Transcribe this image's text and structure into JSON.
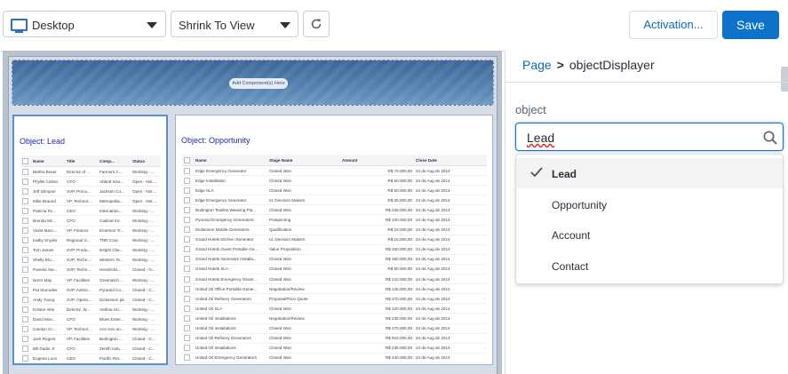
{
  "toolbar": {
    "device": "Desktop",
    "view": "Shrink To View",
    "activation_label": "Activation...",
    "save_label": "Save"
  },
  "canvas": {
    "add_component_label": "Add Component(s) Here",
    "lead": {
      "title": "Object: Lead",
      "columns": [
        "Name",
        "Title",
        "Comp...",
        "Status"
      ],
      "rows": [
        [
          "Bertha Boxer",
          "Director of ...",
          "Farmers C...",
          "Working - ..."
        ],
        [
          "Phyllis Cotton",
          "CFO",
          "Abbott Insu...",
          "Open - Not ..."
        ],
        [
          "Jeff Glimpse",
          "SVP, Procu...",
          "Jackson Co...",
          "Open - Not ..."
        ],
        [
          "Mike Braund",
          "VP, Technol...",
          "Metropolita...",
          "Open - Not ..."
        ],
        [
          "Patricia Fe...",
          "CEO",
          "Internation...",
          "Working - ..."
        ],
        [
          "Brenda Mc...",
          "CFO",
          "Cadinal Inc.",
          "Working - ..."
        ],
        [
          "Violet Macc...",
          "VP, Finance",
          "Emerson Tr...",
          "Working - ..."
        ],
        [
          "Kathy Snyder",
          "Regional G...",
          "TNR Corp.",
          "Working - ..."
        ],
        [
          "Tom James",
          "SVP, Produ...",
          "Delphi Che...",
          "Working - ..."
        ],
        [
          "Shelly Bro...",
          "SVP, Techn...",
          "Western Te...",
          "Working - ..."
        ],
        [
          "Pamela Ow...",
          "SVP, Techn...",
          "Hendricks...",
          "Closed - N..."
        ],
        [
          "Norm May",
          "VP, Facilities",
          "Greenwich ...",
          "Working - ..."
        ],
        [
          "Pat Stumuller",
          "SVP, Admin...",
          "Pyramid Co...",
          "Closed - C..."
        ],
        [
          "Andy Young",
          "SVP, Opera...",
          "Dickenson plc",
          "Closed - C..."
        ],
        [
          "Kristen Akin",
          "Director, W...",
          "Aethna Ho...",
          "Working - ..."
        ],
        [
          "David Mon...",
          "CFO",
          "Blues Enter...",
          "Working - ..."
        ],
        [
          "Carolyn Cr...",
          "VP, Technol...",
          "Ace Iron an...",
          "Working - ..."
        ],
        [
          "Jack Rogers",
          "VP, Facilities",
          "Burlington ...",
          "Closed - C..."
        ],
        [
          "Bill Dadio Jr",
          "CFO",
          "Zenith Indu...",
          "Closed - C..."
        ],
        [
          "Eugena Luce",
          "CEO",
          "Pacific Ret...",
          "Closed - C..."
        ]
      ]
    },
    "opportunity": {
      "title": "Object: Opportunity",
      "columns": [
        "Name",
        "Stage Name",
        "Amount",
        "Close Date"
      ],
      "rows": [
        [
          "Edge Emergency Generator",
          "Closed Won",
          "R$ 75.000,00",
          "24 de Aug de 2014"
        ],
        [
          "Edge Installation",
          "Closed Won",
          "R$ 50.000,00",
          "24 de Aug de 2014"
        ],
        [
          "Edge SLA",
          "Closed Won",
          "R$ 60.000,00",
          "24 de Aug de 2014"
        ],
        [
          "Edge Emergency Generator",
          "Id. Decision Makers",
          "R$ 35.000,00",
          "24 de Aug de 2014"
        ],
        [
          "Burlington Textiles Weaving Pla...",
          "Closed Won",
          "R$ 235.000,00",
          "24 de Aug de 2014"
        ],
        [
          "Pyramid Emergency Generators",
          "Prospecting",
          "R$ 100.000,00",
          "24 de Aug de 2014"
        ],
        [
          "Dickenson Mobile Generators",
          "Qualification",
          "R$ 15.000,00",
          "24 de Aug de 2014"
        ],
        [
          "Grand Hotels Kitchen Generator",
          "Id. Decision Makers",
          "R$ 15.000,00",
          "24 de Aug de 2014"
        ],
        [
          "Grand Hotels Guest Portable Ge...",
          "Value Proposition",
          "R$ 250.000,00",
          "24 de Aug de 2014"
        ],
        [
          "Grand Hotels Generator Installa...",
          "Closed Won",
          "R$ 350.000,00",
          "24 de Aug de 2014"
        ],
        [
          "Grand Hotels SLA",
          "Closed Won",
          "R$ 90.000,00",
          "24 de Aug de 2014"
        ],
        [
          "Grand Hotels Emergency Gener...",
          "Closed Won",
          "R$ 210.000,00",
          "24 de Aug de 2014"
        ],
        [
          "United Oil Office Portable Gener...",
          "Negotiation/Review",
          "R$ 125.000,00",
          "24 de Aug de 2014"
        ],
        [
          "United Oil Refinery Generators",
          "Proposal/Price Quote",
          "R$ 270.000,00",
          "24 de Aug de 2014"
        ],
        [
          "United Oil SLA",
          "Closed Won",
          "R$ 120.000,00",
          "24 de Aug de 2014"
        ],
        [
          "United Oil Installations",
          "Negotiation/Review",
          "R$ 235.000,00",
          "24 de Aug de 2014"
        ],
        [
          "United Oil Installations",
          "Closed Won",
          "R$ 270.000,00",
          "24 de Aug de 2014"
        ],
        [
          "United Oil Refinery Generators",
          "Closed Won",
          "R$ 915.000,00",
          "24 de Aug de 2014"
        ],
        [
          "United Oil Installations",
          "Closed Won",
          "R$ 235.000,00",
          "24 de Aug de 2014"
        ],
        [
          "United Oil Emergency Generators",
          "Closed Won",
          "R$ 440.000,00",
          "24 de Aug de 2014"
        ]
      ]
    }
  },
  "panel": {
    "breadcrumb_root": "Page",
    "breadcrumb_sep": ">",
    "breadcrumb_current": "objectDisplayer",
    "field_label": "object",
    "input_value": "Lead",
    "options": [
      "Lead",
      "Opportunity",
      "Account",
      "Contact"
    ],
    "selected_option": "Lead"
  },
  "colors": {
    "accent": "#0d72c9",
    "link": "#0d6ab3"
  }
}
